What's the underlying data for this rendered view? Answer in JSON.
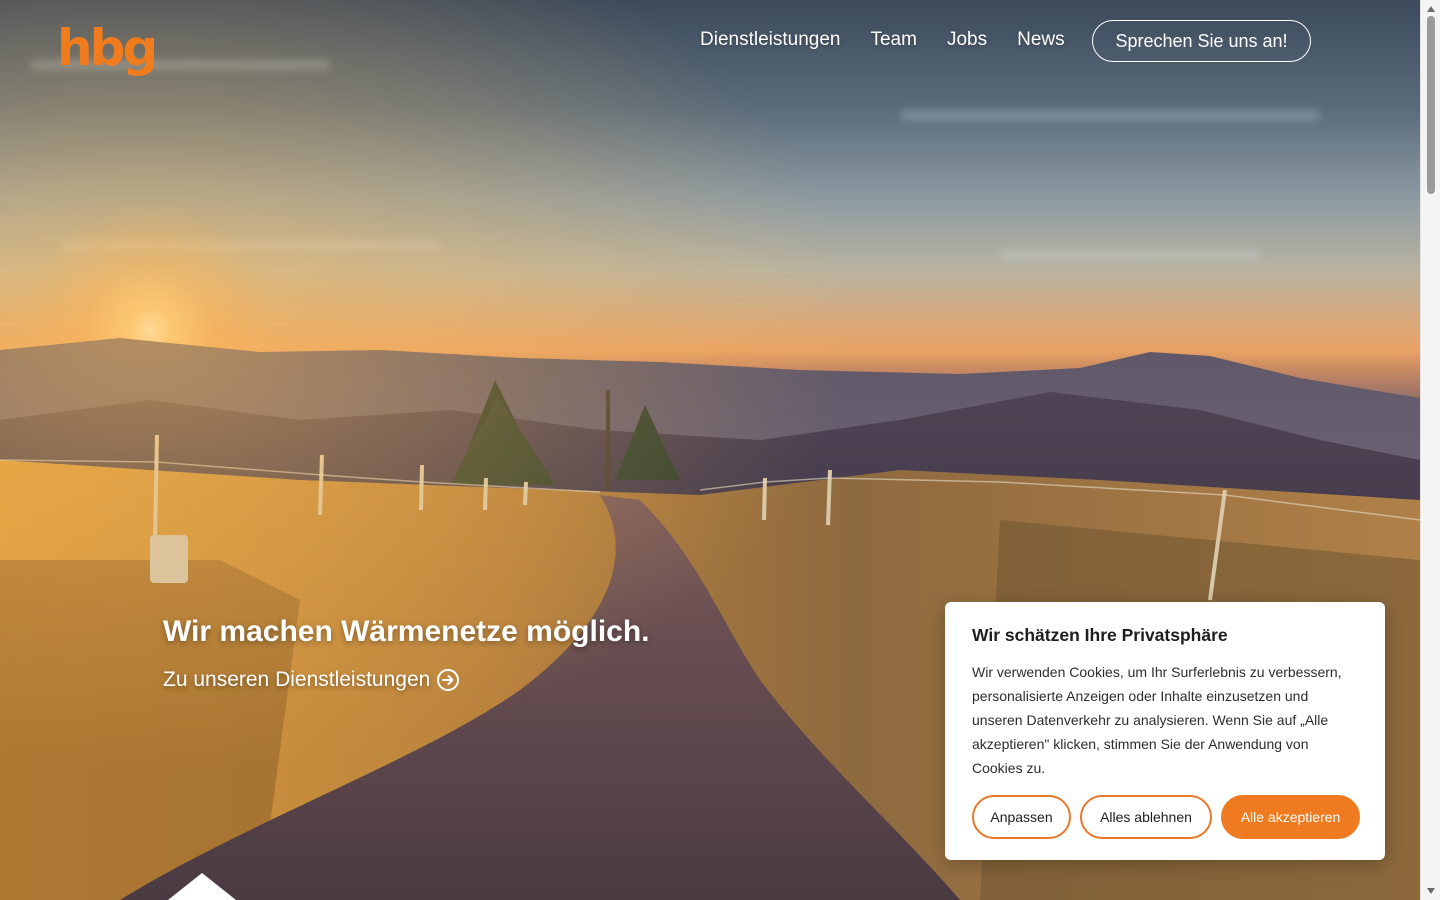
{
  "brand": {
    "logo_text": "hbg",
    "accent_color": "#f07c1d"
  },
  "nav": {
    "items": [
      {
        "label": "Dienstleistungen"
      },
      {
        "label": "Team"
      },
      {
        "label": "Jobs"
      },
      {
        "label": "News"
      }
    ],
    "cta_label": "Sprechen Sie uns an!"
  },
  "hero": {
    "headline": "Wir machen Wärmenetze möglich.",
    "link_label": "Zu unseren Dienstleistungen",
    "link_icon": "arrow-right-circle-icon"
  },
  "cookie_banner": {
    "title": "Wir schätzen Ihre Privatsphäre",
    "body": "Wir verwenden Cookies, um Ihr Surferlebnis zu verbessern, personalisierte Anzeigen oder Inhalte einzusetzen und unseren Datenverkehr zu analysieren. Wenn Sie auf „Alle akzeptieren\" klicken, stimmen Sie der Anwendung von Cookies zu.",
    "buttons": {
      "customize": "Anpassen",
      "reject": "Alles ablehnen",
      "accept": "Alle akzeptieren"
    },
    "accept_color": "#ef7a1f"
  }
}
